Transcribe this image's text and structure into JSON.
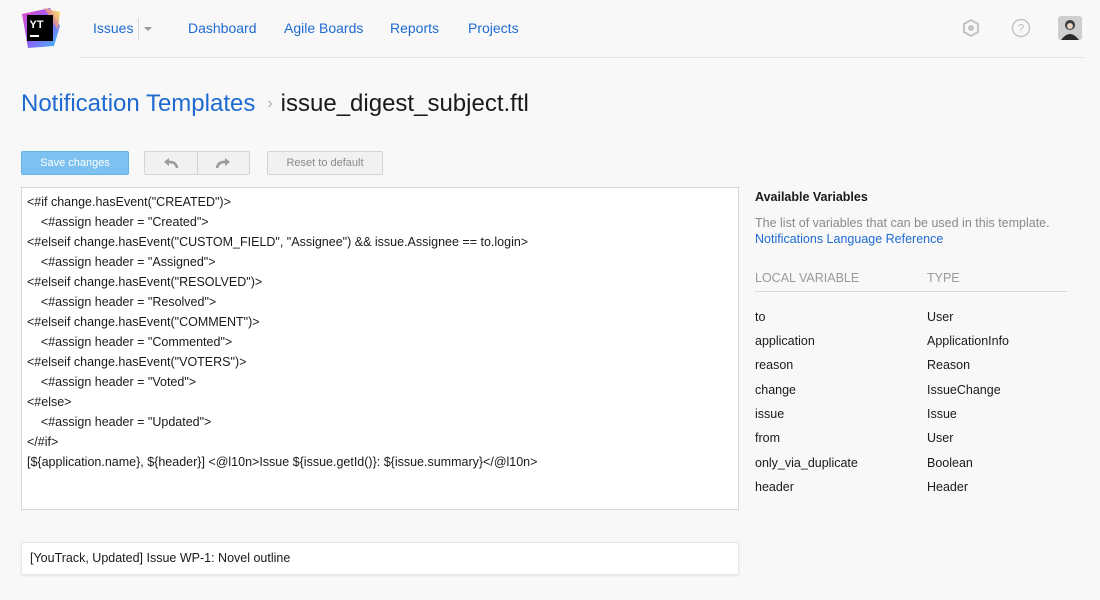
{
  "app": {
    "logo_text": "YT"
  },
  "nav": {
    "items": [
      {
        "label": "Issues"
      },
      {
        "label": "Dashboard"
      },
      {
        "label": "Agile Boards"
      },
      {
        "label": "Reports"
      },
      {
        "label": "Projects"
      }
    ],
    "icons": [
      "settings-icon",
      "help-icon",
      "user-avatar"
    ]
  },
  "breadcrumb": {
    "parent": "Notification Templates",
    "separator": "›",
    "current": "issue_digest_subject.ftl"
  },
  "toolbar": {
    "save_label": "Save changes",
    "reset_label": "Reset to default"
  },
  "editor": {
    "lines": [
      "<#if change.hasEvent(\"CREATED\")>",
      "    <#assign header = \"Created\">",
      "<#elseif change.hasEvent(\"CUSTOM_FIELD\", \"Assignee\") && issue.Assignee == to.login>",
      "    <#assign header = \"Assigned\">",
      "<#elseif change.hasEvent(\"RESOLVED\")>",
      "    <#assign header = \"Resolved\">",
      "<#elseif change.hasEvent(\"COMMENT\")>",
      "    <#assign header = \"Commented\">",
      "<#elseif change.hasEvent(\"VOTERS\")>",
      "    <#assign header = \"Voted\">",
      "<#else>",
      "    <#assign header = \"Updated\">",
      "</#if>",
      "[${application.name}, ${header}] <@l10n>Issue ${issue.getId()}: ${issue.summary}</@l10n>"
    ]
  },
  "preview": {
    "text": "[YouTrack, Updated] Issue WP-1: Novel outline"
  },
  "sidebar": {
    "title": "Available Variables",
    "description": "The list of variables that can be used in this template.",
    "link": "Notifications Language Reference",
    "columns": {
      "name": "LOCAL VARIABLE",
      "type": "TYPE"
    },
    "variables": [
      {
        "name": "to",
        "type": "User"
      },
      {
        "name": "application",
        "type": "ApplicationInfo"
      },
      {
        "name": "reason",
        "type": "Reason"
      },
      {
        "name": "change",
        "type": "IssueChange"
      },
      {
        "name": "issue",
        "type": "Issue"
      },
      {
        "name": "from",
        "type": "User"
      },
      {
        "name": "only_via_duplicate",
        "type": "Boolean"
      },
      {
        "name": "header",
        "type": "Header"
      }
    ]
  },
  "colors": {
    "link": "#1f6ad1",
    "save_button": "#7cc1f0",
    "muted_text": "#8a8a8a"
  }
}
